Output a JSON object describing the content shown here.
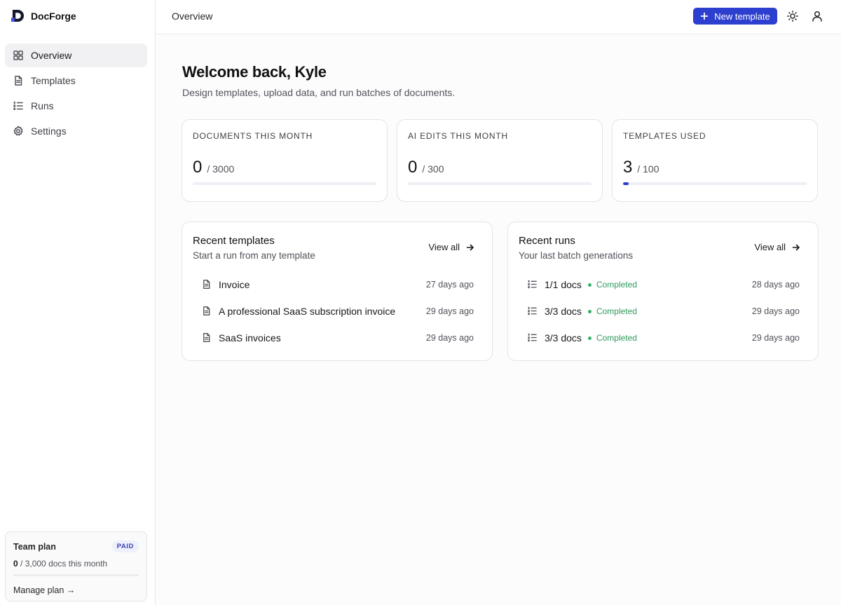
{
  "app": {
    "name": "DocForge"
  },
  "sidebar": {
    "items": [
      {
        "label": "Overview",
        "icon": "grid-icon",
        "active": true
      },
      {
        "label": "Templates",
        "icon": "document-icon",
        "active": false
      },
      {
        "label": "Runs",
        "icon": "list-icon",
        "active": false
      },
      {
        "label": "Settings",
        "icon": "gear-icon",
        "active": false
      }
    ],
    "plan": {
      "name": "Team plan",
      "badge": "PAID",
      "used": "0",
      "usage_text": "/ 3,000 docs this month",
      "link": "Manage plan →"
    }
  },
  "header": {
    "title": "Overview",
    "new_template_label": "New template",
    "accent_color": "#2c3fcf"
  },
  "main": {
    "welcome": "Welcome back, Kyle",
    "subtitle": "Design templates, upload data, and run batches of documents.",
    "stats": [
      {
        "label": "DOCUMENTS THIS MONTH",
        "value": "0",
        "max": "/ 3000",
        "fraction": 0
      },
      {
        "label": "AI EDITS THIS MONTH",
        "value": "0",
        "max": "/ 300",
        "fraction": 0
      },
      {
        "label": "TEMPLATES USED",
        "value": "3",
        "max": "/ 100",
        "fraction": 0.03
      }
    ],
    "recent_templates": {
      "title": "Recent templates",
      "subtitle": "Start a run from any template",
      "view_all": "View all",
      "items": [
        {
          "name": "Invoice",
          "time": "27 days ago"
        },
        {
          "name": "A professional SaaS subscription invoice",
          "time": "29 days ago"
        },
        {
          "name": "SaaS invoices",
          "time": "29 days ago"
        }
      ]
    },
    "recent_runs": {
      "title": "Recent runs",
      "subtitle": "Your last batch generations",
      "view_all": "View all",
      "items": [
        {
          "name": "1/1 docs",
          "status": "Completed",
          "time": "28 days ago"
        },
        {
          "name": "3/3 docs",
          "status": "Completed",
          "time": "29 days ago"
        },
        {
          "name": "3/3 docs",
          "status": "Completed",
          "time": "29 days ago"
        }
      ]
    }
  }
}
